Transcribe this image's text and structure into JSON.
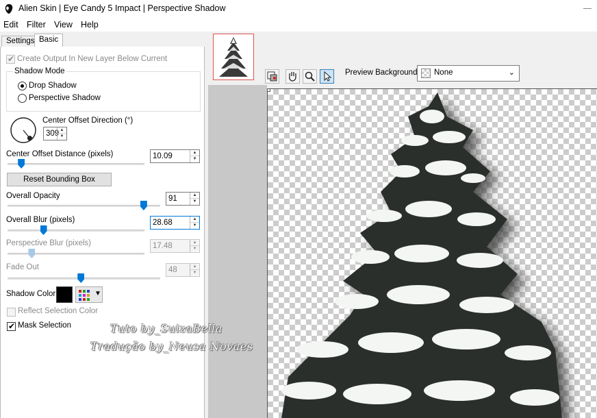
{
  "window": {
    "title": "Alien Skin | Eye Candy 5 Impact | Perspective Shadow"
  },
  "menu": [
    "Edit",
    "Filter",
    "View",
    "Help"
  ],
  "tabs": {
    "settings": "Settings",
    "basic": "Basic"
  },
  "panel": {
    "create_output_label": "Create Output In New Layer Below Current",
    "shadow_mode": {
      "legend": "Shadow Mode",
      "drop": "Drop Shadow",
      "perspective": "Perspective Shadow",
      "selected": "Drop Shadow"
    },
    "direction": {
      "label": "Center Offset Direction (°)",
      "value": "309",
      "angle_deg": 309
    },
    "distance": {
      "label": "Center Offset Distance (pixels)",
      "value": "10.09",
      "slider_fraction": 0.08
    },
    "reset_button": "Reset Bounding Box",
    "opacity": {
      "label": "Overall Opacity",
      "value": "91",
      "slider_fraction": 0.91
    },
    "blur": {
      "label": "Overall Blur (pixels)",
      "value": "28.68",
      "slider_fraction": 0.25
    },
    "perspective_blur": {
      "label": "Perspective Blur (pixels)",
      "value": "17.48",
      "slider_fraction": 0.16
    },
    "fade_out": {
      "label": "Fade Out",
      "value": "48",
      "slider_fraction": 0.48
    },
    "shadow_color": {
      "label": "Shadow Color",
      "value": "#000000"
    },
    "reflect_label": "Reflect Selection Color",
    "mask_label": "Mask Selection"
  },
  "preview": {
    "background_label": "Preview Background:",
    "background_value": "None"
  },
  "watermark": {
    "line1": "Tuto by_SuizaBella",
    "line2": "Tradução by_Neusa Novaes"
  },
  "colors": {
    "accent": "#0078d7",
    "thumb_border": "#e05050"
  }
}
